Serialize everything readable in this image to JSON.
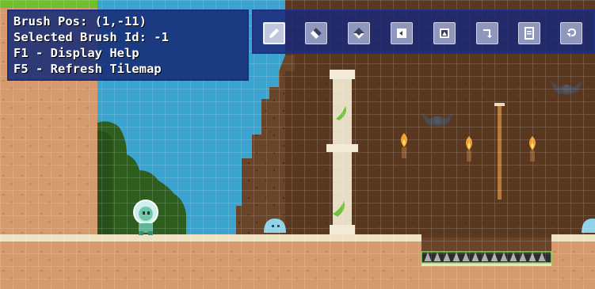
{
  "hud": {
    "brush_pos": "Brush Pos: (1,-11)",
    "brush_id": "Selected Brush Id: -1",
    "help": "F1 - Display Help",
    "refresh": "F5 - Refresh Tilemap"
  },
  "toolbar": {
    "tools": [
      {
        "icon": "pencil-icon",
        "active": true
      },
      {
        "icon": "eraser-icon",
        "active": false
      },
      {
        "icon": "fill-icon",
        "active": false
      },
      {
        "icon": "copy-icon",
        "active": false
      },
      {
        "icon": "image-icon",
        "active": false
      },
      {
        "icon": "arrow-down-icon",
        "active": false
      },
      {
        "icon": "document-icon",
        "active": false
      },
      {
        "icon": "undo-icon",
        "active": false
      }
    ]
  },
  "colors": {
    "sky": "#3aa3cf",
    "cave": "#6a4428",
    "ground": "#d79a6c",
    "grass": "#2e5e1e",
    "panel": "#162c76"
  },
  "entities": [
    {
      "type": "player",
      "icon": "player-character-icon"
    },
    {
      "type": "slime",
      "icon": "slime-icon"
    },
    {
      "type": "slime",
      "icon": "slime-icon"
    },
    {
      "type": "bat",
      "icon": "bat-icon"
    },
    {
      "type": "bat",
      "icon": "bat-icon"
    },
    {
      "type": "torch",
      "icon": "torch-icon"
    },
    {
      "type": "torch",
      "icon": "torch-icon"
    },
    {
      "type": "torch",
      "icon": "torch-icon"
    },
    {
      "type": "rope",
      "icon": "rope-icon"
    },
    {
      "type": "spikes",
      "icon": "spikes-icon"
    },
    {
      "type": "pillar",
      "icon": "pillar-icon"
    }
  ]
}
